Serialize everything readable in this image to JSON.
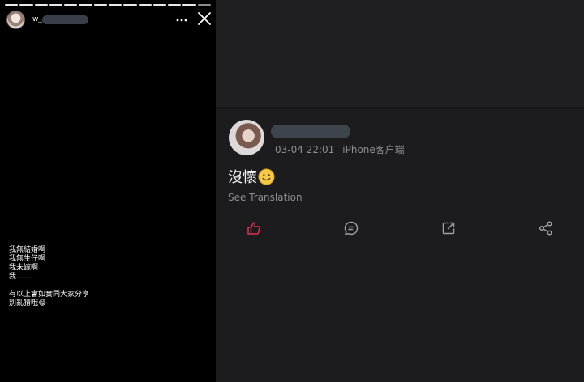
{
  "story": {
    "username_prefix": "w_",
    "progress_segments_total": 14,
    "progress_segments_done": 13,
    "text_lines": [
      "我無結婚啊",
      "我無生仔啊",
      "我未嫁啊",
      "我.......",
      "",
      "有以上會如實同大家分享",
      "別亂猜哦😂"
    ],
    "more_icon": "more-horizontal-icon",
    "close_icon": "close-icon"
  },
  "post": {
    "timestamp": "03-04 22:01",
    "client": "iPhone客户端",
    "content": "沒懷",
    "translate_label": "See Translation"
  },
  "actions": {
    "like_icon": "thumbs-up-icon",
    "comment_icon": "comment-icon",
    "repost_icon": "repost-icon",
    "share_icon": "share-icon",
    "like_color": "#e0314f",
    "icon_color": "#a0a0a4"
  }
}
